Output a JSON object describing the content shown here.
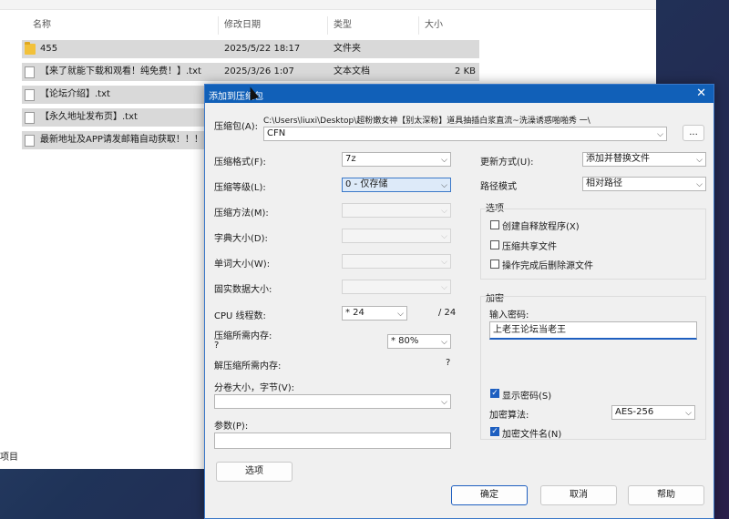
{
  "explorer": {
    "columns": [
      "名称",
      "修改日期",
      "类型",
      "大小"
    ],
    "files": [
      {
        "name": "455",
        "date": "2025/5/22 18:17",
        "type": "文件夹",
        "size": "",
        "icon": "folder-icon"
      },
      {
        "name": "【来了就能下载和观看！纯免费！】.txt",
        "date": "2025/3/26 1:07",
        "type": "文本文档",
        "size": "2 KB",
        "icon": "text-file-icon"
      },
      {
        "name": "【论坛介绍】.txt",
        "date": "",
        "type": "",
        "size": "",
        "icon": "text-file-icon"
      },
      {
        "name": "【永久地址发布页】.txt",
        "date": "",
        "type": "",
        "size": "",
        "icon": "text-file-icon"
      },
      {
        "name": "最新地址及APP请发邮箱自动获取！！！",
        "date": "",
        "type": "",
        "size": "",
        "icon": "text-file-icon"
      }
    ],
    "status": "项目"
  },
  "dialog": {
    "title": "添加到压缩包",
    "archive_label": "压缩包(A):",
    "archive_path": "C:\\Users\\liuxi\\Desktop\\超粉嫩女神【别太深粉】道具抽插白浆直流~洗澡诱惑啪啪秀 一\\",
    "archive_name": "CFN",
    "browse_label": "...",
    "format_label": "压缩格式(F):",
    "format_value": "7z",
    "level_label": "压缩等级(L):",
    "level_value": "0 - 仅存储",
    "method_label": "压缩方法(M):",
    "dict_label": "字典大小(D):",
    "word_label": "单词大小(W):",
    "solid_label": "固实数据大小:",
    "cpu_label": "CPU 线程数:",
    "cpu_value": "* 24",
    "cpu_max": "/ 24",
    "mem_comp_label": "压缩所需内存:",
    "mem_comp_q": "?",
    "mem_comp_value": "* 80%",
    "mem_decomp_label": "解压缩所需内存:",
    "mem_decomp_value": "?",
    "volume_label": "分卷大小，字节(V):",
    "params_label": "参数(P):",
    "options_button": "选项",
    "update_label": "更新方式(U):",
    "update_value": "添加并替换文件",
    "path_label": "路径模式",
    "path_value": "相对路径",
    "options_group": "选项",
    "opt_sfx": "创建自释放程序(X)",
    "opt_shared": "压缩共享文件",
    "opt_delete": "操作完成后删除源文件",
    "enc_group": "加密",
    "enc_pwd_label": "输入密码:",
    "enc_pwd_value": "上老王论坛当老王",
    "show_pwd": "显示密码(S)",
    "enc_method_label": "加密算法:",
    "enc_method_value": "AES-256",
    "enc_names": "加密文件名(N)",
    "ok": "确定",
    "cancel": "取消",
    "help": "帮助"
  }
}
